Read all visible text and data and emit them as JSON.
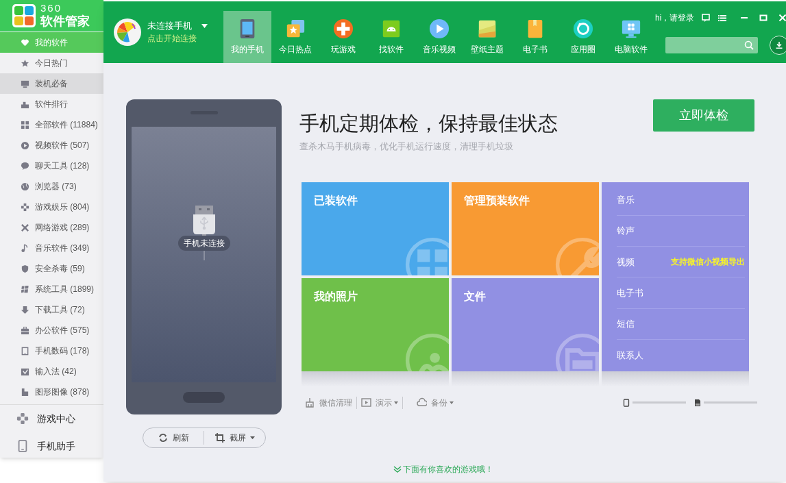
{
  "back_window": {
    "logo_number": "360",
    "logo_title": "软件管家",
    "sidebar": [
      {
        "label": "我的软件",
        "selected": true,
        "highlighted": false
      },
      {
        "label": "今日热门",
        "selected": false,
        "highlighted": false
      },
      {
        "label": "装机必备",
        "selected": false,
        "highlighted": true
      },
      {
        "label": "软件排行",
        "selected": false,
        "highlighted": false
      },
      {
        "label": "全部软件 (11884)",
        "selected": false,
        "highlighted": false
      },
      {
        "label": "视频软件 (507)",
        "selected": false,
        "highlighted": false
      },
      {
        "label": "聊天工具 (128)",
        "selected": false,
        "highlighted": false
      },
      {
        "label": "浏览器 (73)",
        "selected": false,
        "highlighted": false
      },
      {
        "label": "游戏娱乐 (804)",
        "selected": false,
        "highlighted": false
      },
      {
        "label": "网络游戏 (289)",
        "selected": false,
        "highlighted": false
      },
      {
        "label": "音乐软件 (349)",
        "selected": false,
        "highlighted": false
      },
      {
        "label": "安全杀毒 (59)",
        "selected": false,
        "highlighted": false
      },
      {
        "label": "系统工具 (1899)",
        "selected": false,
        "highlighted": false
      },
      {
        "label": "下载工具 (72)",
        "selected": false,
        "highlighted": false
      },
      {
        "label": "办公软件 (575)",
        "selected": false,
        "highlighted": false
      },
      {
        "label": "手机数码 (178)",
        "selected": false,
        "highlighted": false
      },
      {
        "label": "输入法 (42)",
        "selected": false,
        "highlighted": false
      },
      {
        "label": "图形图像 (878)",
        "selected": false,
        "highlighted": false
      }
    ],
    "bottom_links": [
      "游戏中心",
      "手机助手"
    ]
  },
  "header": {
    "device_status": "未连接手机",
    "connect_hint": "点击开始连接",
    "login": "hi，请登录",
    "tabs": [
      {
        "label": "我的手机",
        "selected": true
      },
      {
        "label": "今日热点",
        "selected": false
      },
      {
        "label": "玩游戏",
        "selected": false
      },
      {
        "label": "找软件",
        "selected": false
      },
      {
        "label": "音乐视频",
        "selected": false
      },
      {
        "label": "壁纸主题",
        "selected": false
      },
      {
        "label": "电子书",
        "selected": false
      },
      {
        "label": "应用圈",
        "selected": false
      },
      {
        "label": "电脑软件",
        "selected": false
      }
    ]
  },
  "phone": {
    "status": "手机未连接",
    "buttons": [
      {
        "label": "刷新",
        "dropdown": false
      },
      {
        "label": "截屏",
        "dropdown": true
      }
    ]
  },
  "checkup": {
    "title": "手机定期体检，保持最佳状态",
    "subtitle": "查杀木马手机病毒，优化手机运行速度，清理手机垃圾",
    "button": "立即体检"
  },
  "tiles": [
    {
      "label": "已装软件",
      "color": "#4aa8eb"
    },
    {
      "label": "管理预装软件",
      "color": "#f89a33"
    },
    {
      "label": "我的照片",
      "color": "#6fc04a"
    },
    {
      "label": "文件",
      "color": "#9190e3"
    }
  ],
  "media_list": {
    "items": [
      {
        "label": "音乐"
      },
      {
        "label": "铃声"
      },
      {
        "label": "视频",
        "note": "支持微信小视频导出"
      },
      {
        "label": "电子书"
      },
      {
        "label": "短信"
      },
      {
        "label": "联系人"
      }
    ]
  },
  "toolbar": [
    {
      "label": "微信清理",
      "dropdown": false
    },
    {
      "label": "演示",
      "dropdown": true
    },
    {
      "label": "备份",
      "dropdown": true
    }
  ],
  "footer_link": "下面有你喜欢的游戏哦！"
}
